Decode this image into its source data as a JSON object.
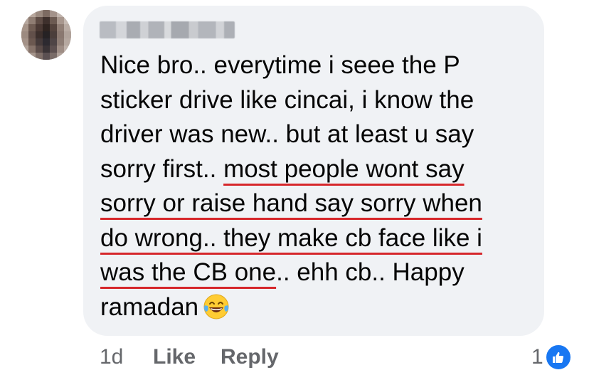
{
  "comment": {
    "author": "",
    "lines": [
      {
        "pre": "Nice bro.. everytime i seee the P",
        "hl": "",
        "post": ""
      },
      {
        "pre": "sticker drive like cincai, i know the",
        "hl": "",
        "post": ""
      },
      {
        "pre": "driver was new.. but at least u say",
        "hl": "",
        "post": ""
      },
      {
        "pre": "sorry first.. ",
        "hl": "most people wont say",
        "post": ""
      },
      {
        "pre": "",
        "hl": "sorry or raise hand say sorry when",
        "post": ""
      },
      {
        "pre": "",
        "hl": "do wrong.. they make cb face like i",
        "post": ""
      },
      {
        "pre": "",
        "hl": "was the CB one",
        "post": ".. ehh cb.. Happy"
      },
      {
        "pre": "ramadan",
        "hl": "",
        "post": ""
      }
    ],
    "emoji": "face-with-tears-of-joy",
    "highlight_color": "#d6272b"
  },
  "actions": {
    "time": "1d",
    "like_label": "Like",
    "reply_label": "Reply"
  },
  "reactions": {
    "count": "1",
    "type": "like-icon",
    "color": "#1877f2"
  }
}
